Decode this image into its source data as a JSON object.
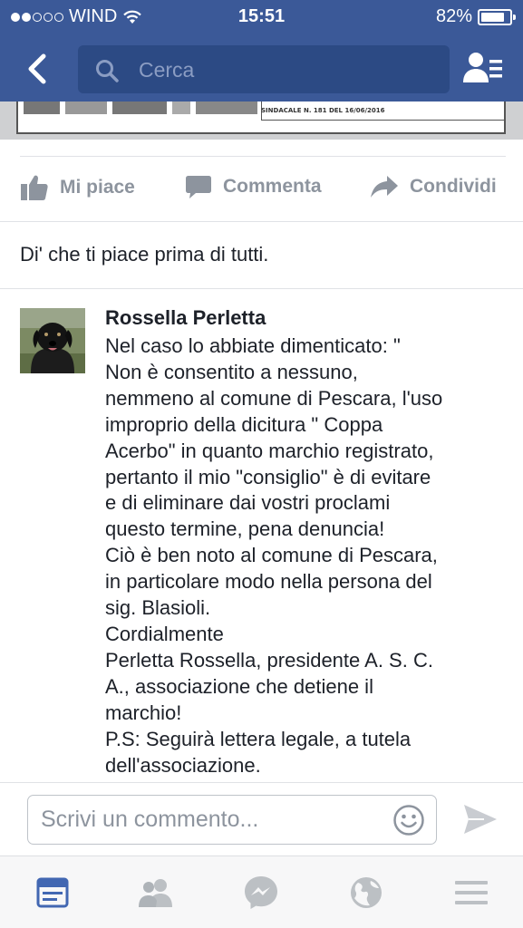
{
  "status_bar": {
    "carrier": "WIND",
    "time": "15:51",
    "battery": "82%",
    "battery_level": 0.82
  },
  "nav": {
    "back_icon": "chevron-left-icon",
    "search_placeholder": "Cerca",
    "friends_icon": "friend-requests-icon"
  },
  "post_image": {
    "caption": "SINDACALE N. 181 DEL 16/06/2016"
  },
  "actions": {
    "like": "Mi piace",
    "comment": "Commenta",
    "share": "Condividi"
  },
  "like_prompt": "Di' che ti piace prima di tutti.",
  "comment": {
    "author": "Rossella Perletta",
    "lines": [
      "Nel caso lo abbiate dimenticato: \"",
      "Non è consentito a nessuno,",
      "nemmeno al comune di Pescara, l'uso",
      "improprio della dicitura \" Coppa",
      "Acerbo\" in quanto marchio registrato,",
      "pertanto il mio \"consiglio\" è di evitare",
      "e di eliminare dai vostri proclami",
      "questo termine, pena denuncia!",
      "Ciò è ben noto al comune di Pescara,",
      "in particolare modo nella persona del",
      "sig. Blasioli.",
      "Cordialmente",
      "Perletta Rossella, presidente A. S. C.",
      "A., associazione che detiene il",
      "marchio!",
      "P.S: Seguirà lettera legale, a tutela",
      "dell'associazione."
    ]
  },
  "composer": {
    "placeholder": "Scrivi un commento...",
    "emoji_icon": "smiley-icon",
    "send_icon": "send-icon"
  },
  "tabs": [
    "news-feed-icon",
    "friends-icon",
    "messenger-icon",
    "globe-icon",
    "menu-icon"
  ],
  "colors": {
    "brand": "#3b5998",
    "active_tab": "#4267b2",
    "inactive": "#8d949e"
  }
}
